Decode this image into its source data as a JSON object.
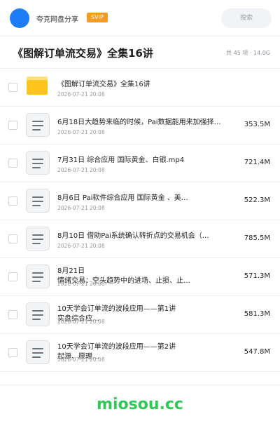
{
  "header": {
    "share_label": "夸克网盘分享",
    "badge": "SVIP",
    "search_placeholder": "搜索",
    "avatar_color": "#1e7cf7"
  },
  "title_row": {
    "title": "《图解订单流交易》全集16讲",
    "meta": "共 45 项 · 14.0G"
  },
  "files": [
    {
      "type": "folder",
      "name": "《图解订单流交易》全集16讲",
      "date": "2026-07-21 20:08",
      "size": ""
    },
    {
      "type": "file",
      "name": "6月18日大趋势来临的时候，Pai数据能用来加强择…",
      "date": "2026-07-21 20:08",
      "size": "353.5M"
    },
    {
      "type": "file",
      "name": "7月31日 综合应用 国际黄金、白银.mp4",
      "date": "2026-07-21 20:08",
      "size": "721.4M"
    },
    {
      "type": "file",
      "name": "8月6日  Pai软件综合应用  国际黄金 、美…",
      "date": "2026-07-21 20:08",
      "size": "522.3M"
    },
    {
      "type": "file",
      "name": "8月10日  借助Pai系统确认转折点的交易机会（…",
      "date": "2026-07-21 20:08",
      "size": "785.5M"
    },
    {
      "type": "file",
      "name": "8月21日\n情绪交易：空头趋势中的进场、止损、止…",
      "date": "2026-07-21 20:08",
      "size": "571.3M"
    },
    {
      "type": "file",
      "name": "10天学会订单流的波段应用——第1讲\n实盘综合应…",
      "date": "2026-07-21 20:08",
      "size": "581.3M"
    },
    {
      "type": "file",
      "name": "10天学会订单流的波段应用——第2讲\n起源、原理…",
      "date": "2026-07-21 20:08",
      "size": "547.8M"
    }
  ],
  "footer": {
    "brand": "miosou.cc",
    "brand_color": "#33c75a"
  }
}
